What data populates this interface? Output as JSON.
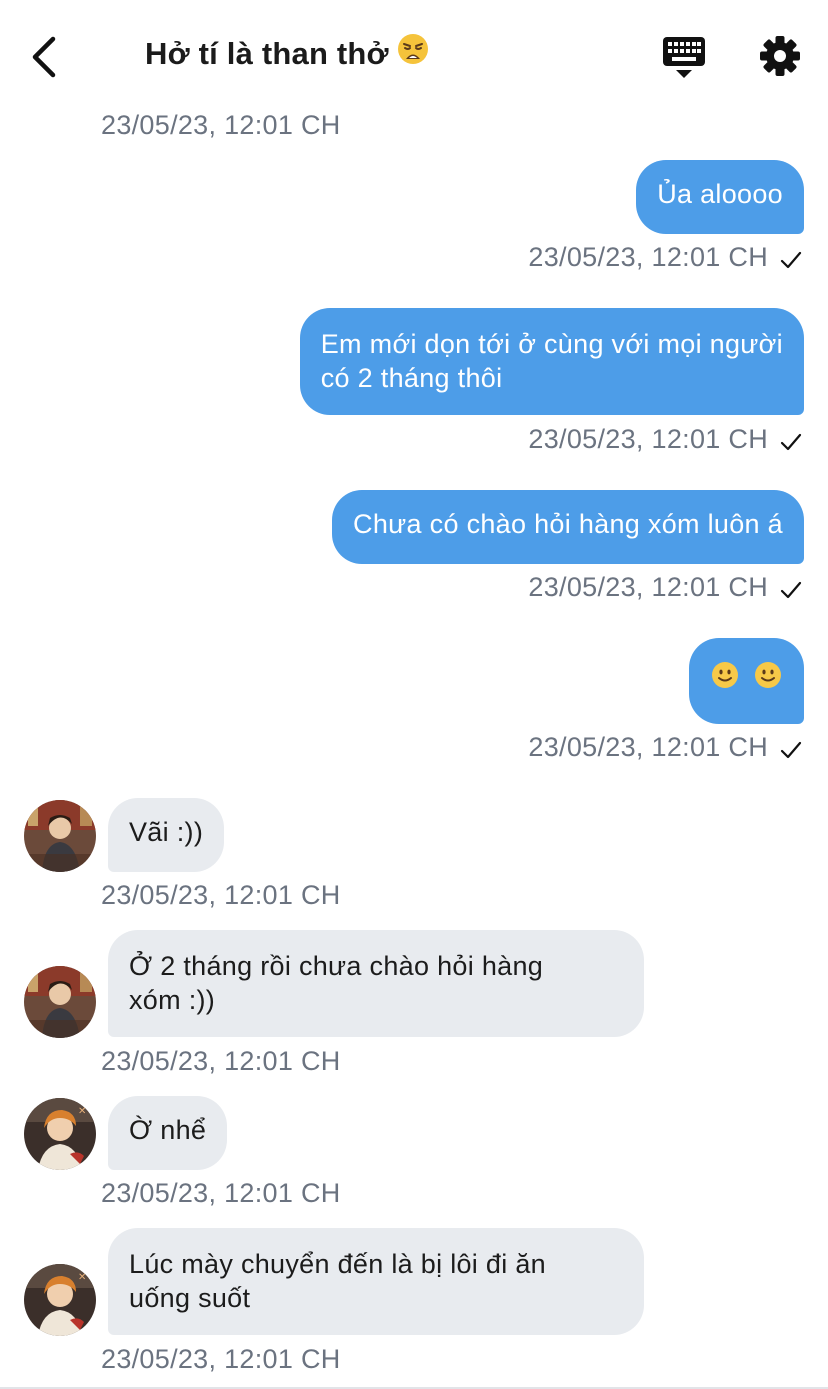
{
  "header": {
    "title": "Hở tí là than thở",
    "title_emoji": "weary-face-emoji",
    "back_icon": "chevron-left-icon",
    "keyboard_icon": "keyboard-icon",
    "settings_icon": "gear-icon"
  },
  "colors": {
    "sent_bubble": "#4d9de8",
    "received_bubble": "#e8ebef",
    "timestamp": "#6b7380"
  },
  "messages": [
    {
      "direction": "in",
      "timestamp": "23/05/23, 12:01 CH"
    },
    {
      "direction": "out",
      "lines": [
        "Ủa aloooo"
      ],
      "timestamp": "23/05/23, 12:01 CH",
      "status_icon": "checkmark-icon"
    },
    {
      "direction": "out",
      "lines": [
        "Em mới dọn tới ở cùng với mọi người",
        "có 2 tháng thôi"
      ],
      "timestamp": "23/05/23, 12:01 CH",
      "status_icon": "checkmark-icon"
    },
    {
      "direction": "out",
      "lines": [
        "Chưa có chào hỏi hàng xóm luôn á"
      ],
      "timestamp": "23/05/23, 12:01 CH",
      "status_icon": "checkmark-icon"
    },
    {
      "direction": "out",
      "emojis": [
        "slightly-smiling-face-emoji",
        "slightly-smiling-face-emoji"
      ],
      "timestamp": "23/05/23, 12:01 CH",
      "status_icon": "checkmark-icon"
    },
    {
      "direction": "in",
      "lines": [
        "Vãi :))"
      ],
      "timestamp": "23/05/23, 12:01 CH",
      "avatar": "avatar-user-1"
    },
    {
      "direction": "in",
      "lines": [
        "Ở 2 tháng rồi chưa chào hỏi hàng",
        "xóm :))"
      ],
      "timestamp": "23/05/23, 12:01 CH",
      "avatar": "avatar-user-1"
    },
    {
      "direction": "in",
      "lines": [
        "Ờ nhể"
      ],
      "timestamp": "23/05/23, 12:01 CH",
      "avatar": "avatar-user-2"
    },
    {
      "direction": "in",
      "lines": [
        "Lúc mày chuyển đến là bị lôi đi ăn",
        "uống suốt"
      ],
      "timestamp": "23/05/23, 12:01 CH",
      "avatar": "avatar-user-2"
    }
  ]
}
